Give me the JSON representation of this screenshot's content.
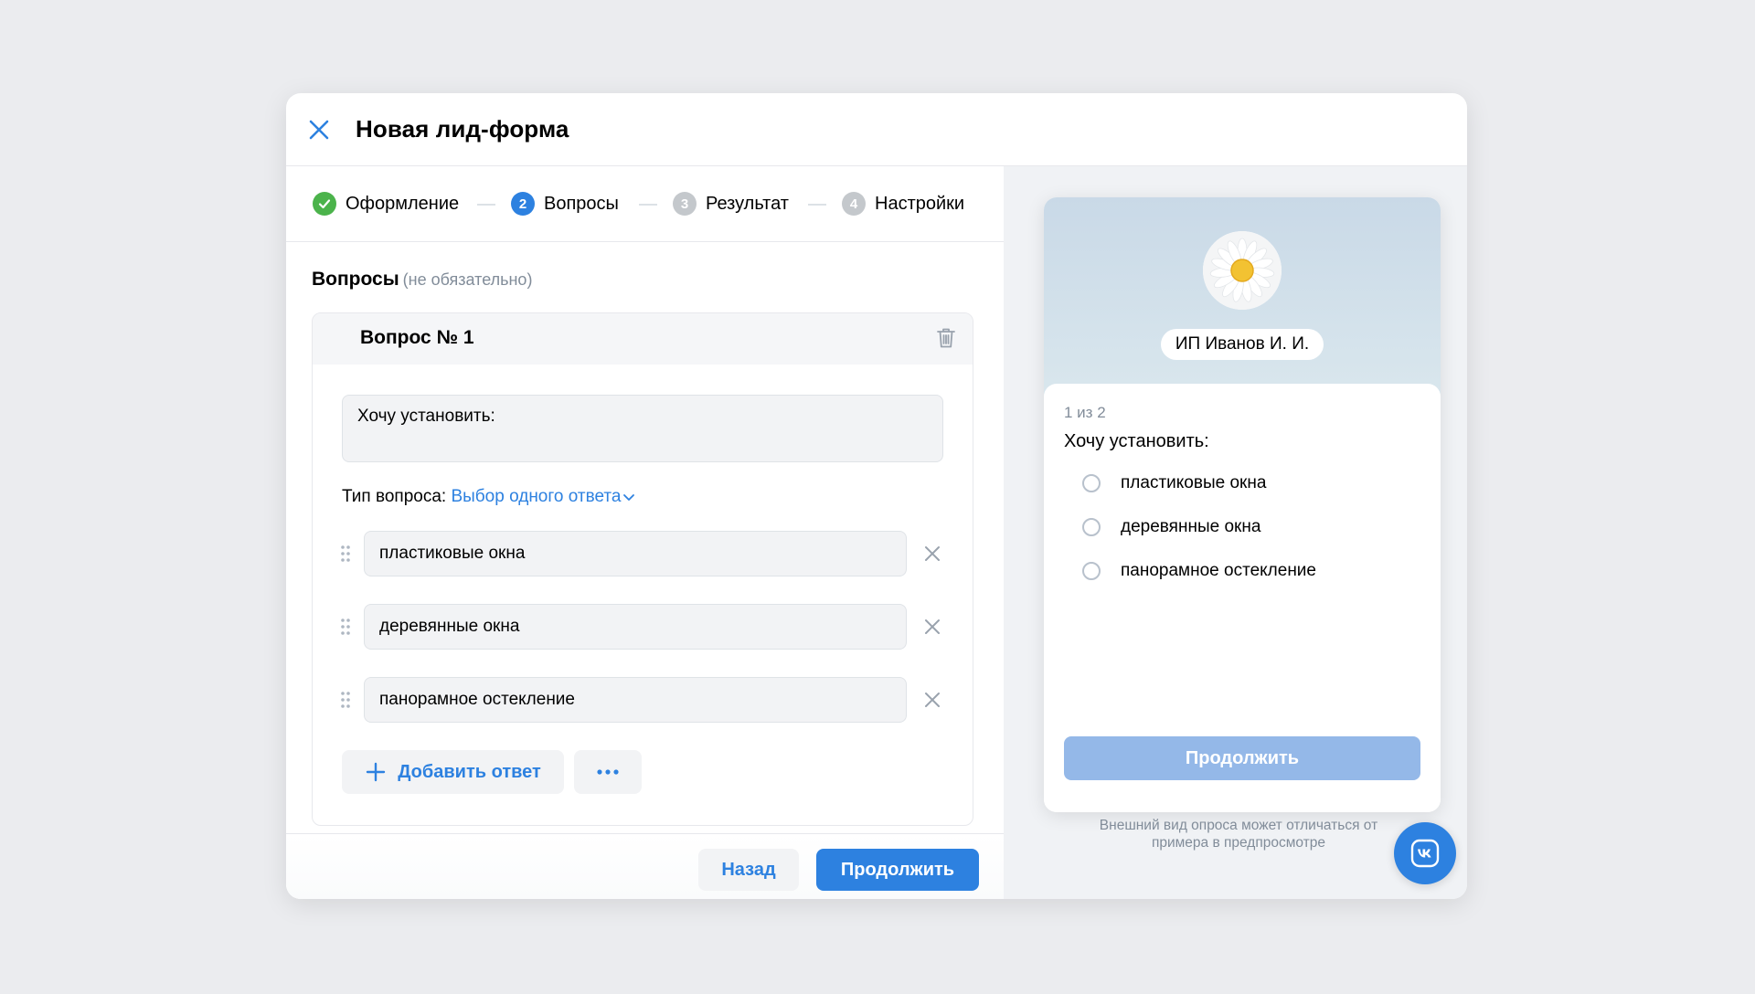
{
  "modal": {
    "title": "Новая лид-форма"
  },
  "steps": [
    {
      "label": "Оформление",
      "state": "done"
    },
    {
      "label": "Вопросы",
      "number": "2",
      "state": "active"
    },
    {
      "label": "Результат",
      "number": "3",
      "state": "upcoming"
    },
    {
      "label": "Настройки",
      "number": "4",
      "state": "upcoming"
    }
  ],
  "section": {
    "title": "Вопросы",
    "hint": "(не обязательно)"
  },
  "question": {
    "title": "Вопрос № 1",
    "text": "Хочу установить:",
    "type_label": "Тип вопроса:",
    "type_value": "Выбор одного ответа",
    "answers": [
      "пластиковые окна",
      "деревянные окна",
      "панорамное остекление"
    ],
    "add_answer_label": "Добавить ответ"
  },
  "footer": {
    "back_label": "Назад",
    "continue_label": "Продолжить"
  },
  "preview": {
    "company_name": "ИП Иванов И. И.",
    "counter": "1 из 2",
    "question": "Хочу установить:",
    "options": [
      "пластиковые окна",
      "деревянные окна",
      "панорамное остекление"
    ],
    "continue_label": "Продолжить",
    "notice": "Внешний вид опроса может отличаться от примера в предпросмотре"
  },
  "colors": {
    "accent": "#2d81e0",
    "done": "#4bb34b",
    "inactive_step": "#c4c8cc",
    "preview_button": "#94b8e8"
  }
}
